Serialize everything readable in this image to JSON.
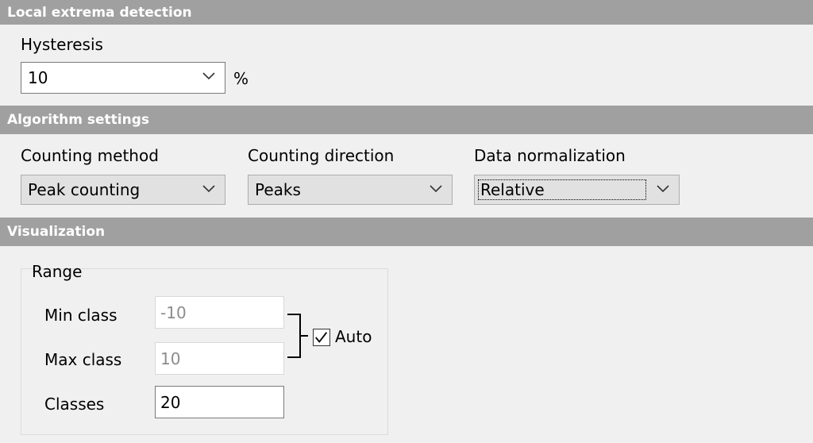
{
  "sections": {
    "local_extrema": {
      "title": "Local extrema detection"
    },
    "algorithm": {
      "title": "Algorithm settings"
    },
    "visualization": {
      "title": "Visualization"
    }
  },
  "hysteresis": {
    "label": "Hysteresis",
    "value": "10",
    "unit": "%"
  },
  "counting_method": {
    "label": "Counting method",
    "value": "Peak counting"
  },
  "counting_direction": {
    "label": "Counting direction",
    "value": "Peaks"
  },
  "data_normalization": {
    "label": "Data normalization",
    "value": "Relative"
  },
  "range": {
    "group_label": "Range",
    "min_class": {
      "label": "Min class",
      "value": "-10"
    },
    "max_class": {
      "label": "Max class",
      "value": "10"
    },
    "classes": {
      "label": "Classes",
      "value": "20"
    },
    "auto": {
      "label": "Auto",
      "checked": true
    }
  },
  "icons": {
    "dropdown": "chevron-down-icon",
    "check": "checkmark-icon"
  }
}
